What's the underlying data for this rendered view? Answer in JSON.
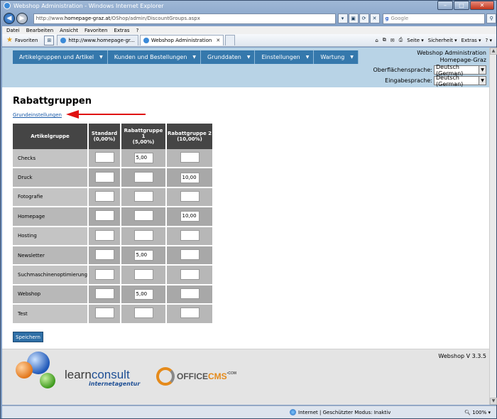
{
  "window": {
    "title": "Webshop Administration - Windows Internet Explorer",
    "controls": [
      "–",
      "□",
      "✕"
    ]
  },
  "browser": {
    "address": {
      "prefix": "http://www.",
      "host": "homepage-graz.at",
      "path": "/OShop/admin/DiscountGroups.aspx"
    },
    "search_placeholder": "Google",
    "menu": [
      "Datei",
      "Bearbeiten",
      "Ansicht",
      "Favoriten",
      "Extras",
      "?"
    ],
    "favorites_label": "Favoriten",
    "tabs": [
      {
        "label": "http://www.homepage-gr...",
        "active": false
      },
      {
        "label": "Webshop Administration",
        "active": true
      }
    ],
    "commands": [
      "Seite ▾",
      "Sicherheit ▾",
      "Extras ▾",
      "? ▾"
    ],
    "status": {
      "zone": "Internet | Geschützter Modus: Inaktiv",
      "zoom": "100%"
    }
  },
  "header": {
    "menu": [
      "Artikelgruppen und Artikel",
      "Kunden und Bestellungen",
      "Grunddaten",
      "Einstellungen",
      "Wartung"
    ],
    "app_name": "Webshop Administration",
    "site_name": "Homepage-Graz",
    "ui_language_label": "Oberflächensprache:",
    "ui_language_value": "Deutsch (German)",
    "input_language_label": "Eingabesprache:",
    "input_language_value": "Deutsch (German)"
  },
  "page": {
    "title": "Rabattgruppen",
    "basic_settings_link": "Grundeinstellungen",
    "save_label": "Speichern"
  },
  "table": {
    "headers": [
      {
        "line1": "Artikelgruppe",
        "line2": ""
      },
      {
        "line1": "Standard",
        "line2": "(0,00%)"
      },
      {
        "line1": "Rabattgruppe 1",
        "line2": "(5,00%)"
      },
      {
        "line1": "Rabattgruppe 2",
        "line2": "(10,00%)"
      }
    ],
    "rows": [
      {
        "name": "Checks",
        "values": [
          "",
          "5,00",
          ""
        ]
      },
      {
        "name": "Druck",
        "values": [
          "",
          "",
          "10,00"
        ]
      },
      {
        "name": "Fotografie",
        "values": [
          "",
          "",
          ""
        ]
      },
      {
        "name": "Homepage",
        "values": [
          "",
          "",
          "10,00"
        ]
      },
      {
        "name": "Hosting",
        "values": [
          "",
          "",
          ""
        ]
      },
      {
        "name": "Newsletter",
        "values": [
          "",
          "5,00",
          ""
        ]
      },
      {
        "name": "Suchmaschinenoptimierung",
        "values": [
          "",
          "",
          ""
        ]
      },
      {
        "name": "Webshop",
        "values": [
          "",
          "5,00",
          ""
        ]
      },
      {
        "name": "Test",
        "values": [
          "",
          "",
          ""
        ]
      }
    ]
  },
  "footer": {
    "version": "Webshop V 3.3.5",
    "logo1_part_a": "learn",
    "logo1_part_b": "consult",
    "logo1_tagline": "internetagentur",
    "logo2_part_a": "OFFICE",
    "logo2_part_b": "CMS",
    "logo2_sup": "•COM"
  },
  "colors": {
    "menu_bg": "#3578ac",
    "header_bg": "#b8d3e6",
    "table_header_bg": "#454545",
    "annotation_arrow": "#e01010"
  }
}
